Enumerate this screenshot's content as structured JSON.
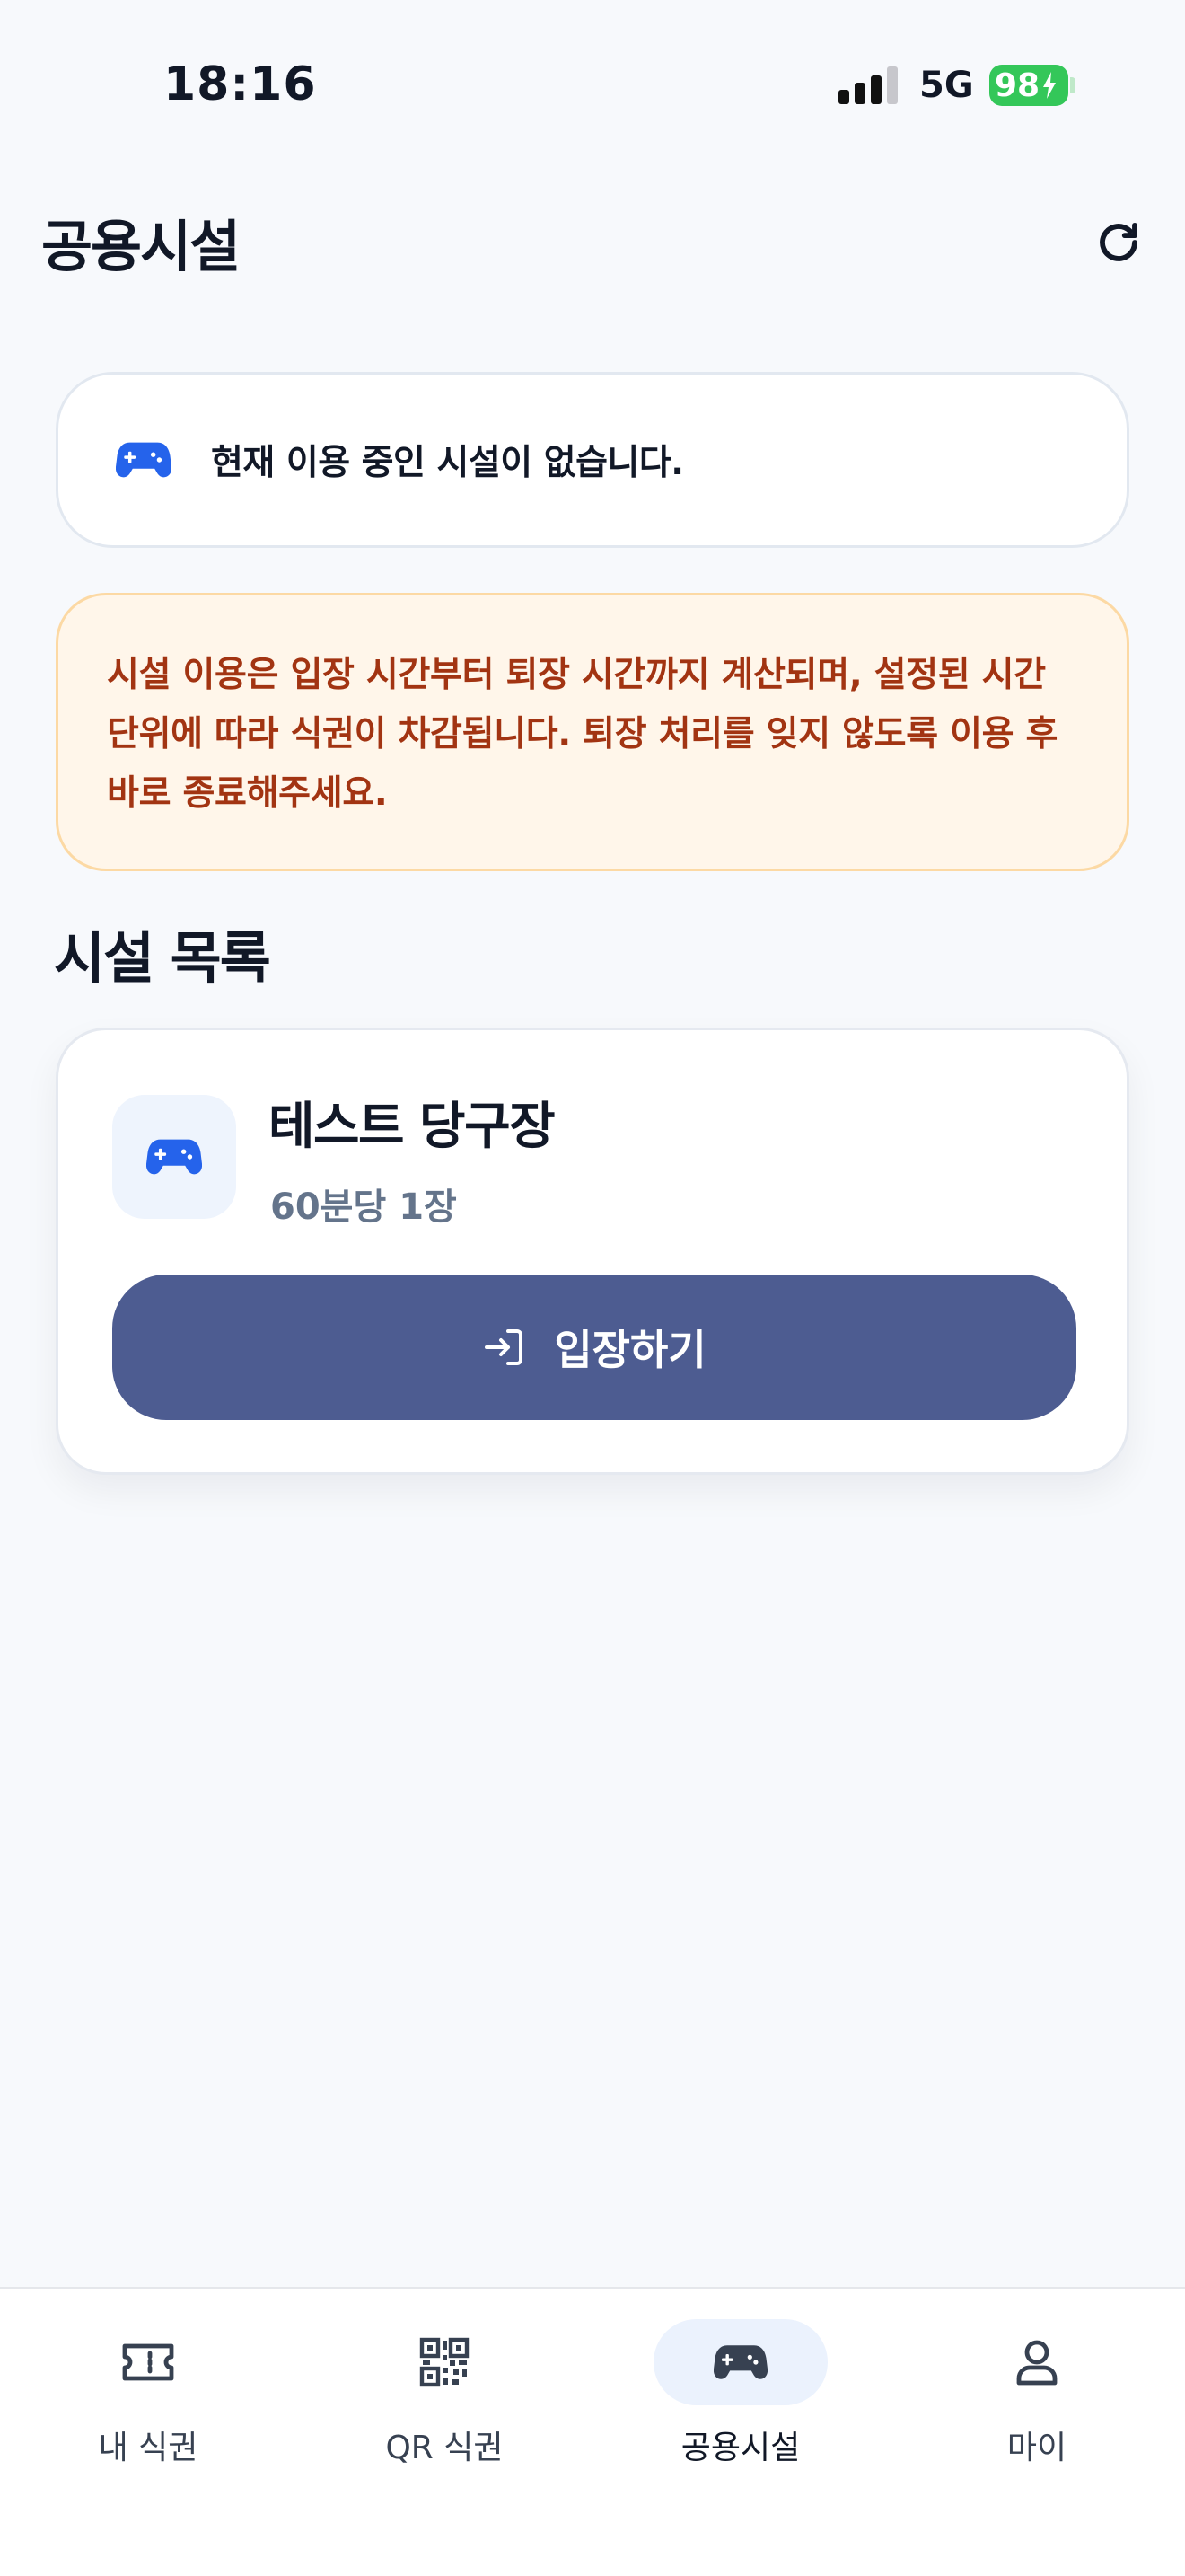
{
  "status_bar": {
    "time": "18:16",
    "network": "5G",
    "battery": "98"
  },
  "header": {
    "title": "공용시설",
    "refresh_icon": "refresh-icon"
  },
  "current_status": {
    "icon": "gamepad-icon",
    "text": "현재 이용 중인 시설이 없습니다."
  },
  "notice": {
    "lines": [
      "시설 이용은 입장 시간부터 퇴장 시간까지 계산되며, 설정된 시간",
      "단위에 따라 식권이 차감됩니다. 퇴장 처리를 잊지 않도록 이용 후",
      "바로 종료해주세요."
    ]
  },
  "facilities": {
    "section_title": "시설 목록",
    "items": [
      {
        "icon": "gamepad-icon",
        "name": "테스트 당구장",
        "rate": "60분당 1장",
        "button_label": "입장하기",
        "button_icon": "login-icon"
      }
    ]
  },
  "bottom_nav": {
    "items": [
      {
        "label": "내 식권",
        "icon": "ticket-icon",
        "active": false
      },
      {
        "label": "QR 식권",
        "icon": "qr-code-icon",
        "active": false
      },
      {
        "label": "공용시설",
        "icon": "gamepad-icon",
        "active": true
      },
      {
        "label": "마이",
        "icon": "person-icon",
        "active": false
      }
    ]
  },
  "colors": {
    "primary": "#4d5c91",
    "accent_blue": "#2563eb",
    "notice_text": "#a23412",
    "notice_bg": "#fff6ea",
    "battery": "#34c759"
  }
}
